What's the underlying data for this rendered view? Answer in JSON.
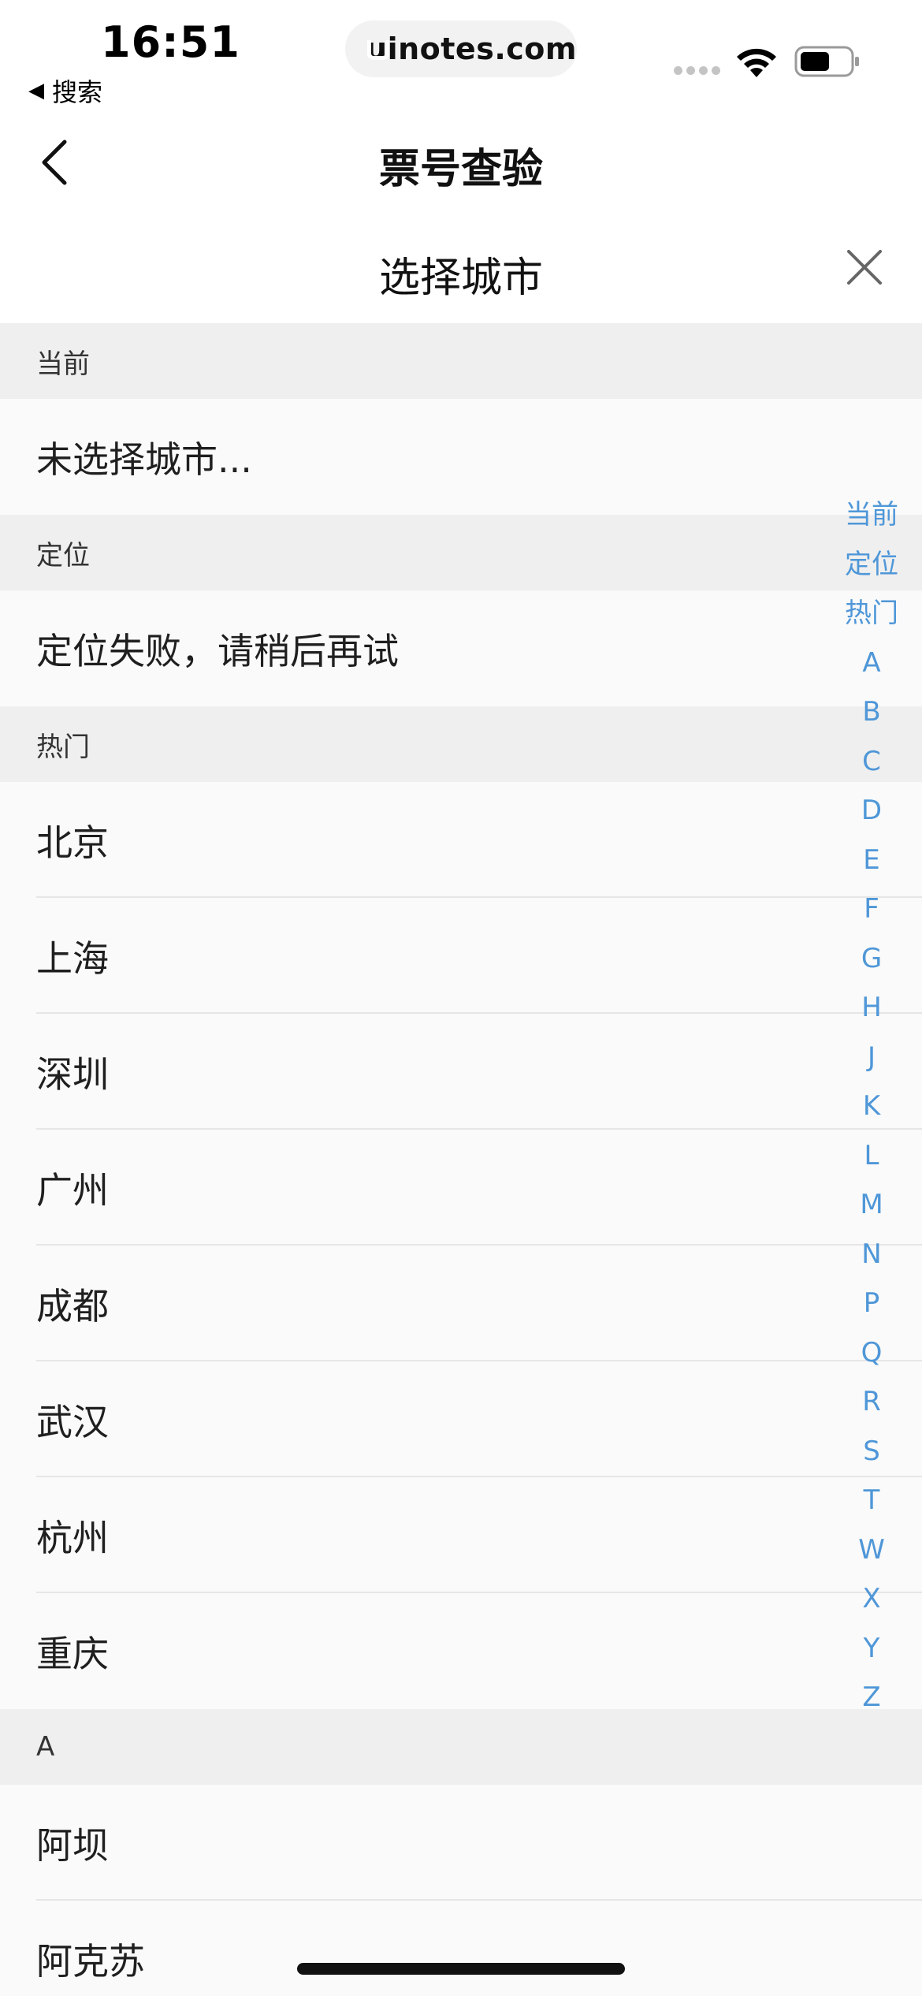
{
  "status_bar": {
    "time": "16:51",
    "back_label": "搜索",
    "url": "uinotes.com",
    "icons": [
      "cellular-dots-icon",
      "wifi-icon",
      "battery-icon"
    ]
  },
  "nav": {
    "title": "票号查验"
  },
  "sheet": {
    "title": "选择城市"
  },
  "sections": [
    {
      "header": "当前",
      "items": [
        "未选择城市..."
      ]
    },
    {
      "header": "定位",
      "items": [
        "定位失败，请稍后再试"
      ]
    },
    {
      "header": "热门",
      "items": [
        "北京",
        "上海",
        "深圳",
        "广州",
        "成都",
        "武汉",
        "杭州",
        "重庆"
      ]
    },
    {
      "header": "A",
      "items": [
        "阿坝",
        "阿克苏"
      ]
    }
  ],
  "index_bar": [
    "当前",
    "定位",
    "热门",
    "A",
    "B",
    "C",
    "D",
    "E",
    "F",
    "G",
    "H",
    "J",
    "K",
    "L",
    "M",
    "N",
    "P",
    "Q",
    "R",
    "S",
    "T",
    "W",
    "X",
    "Y",
    "Z"
  ],
  "colors": {
    "accent": "#4f97d8",
    "section_bg": "#efefef",
    "row_bg": "#fafafa"
  }
}
